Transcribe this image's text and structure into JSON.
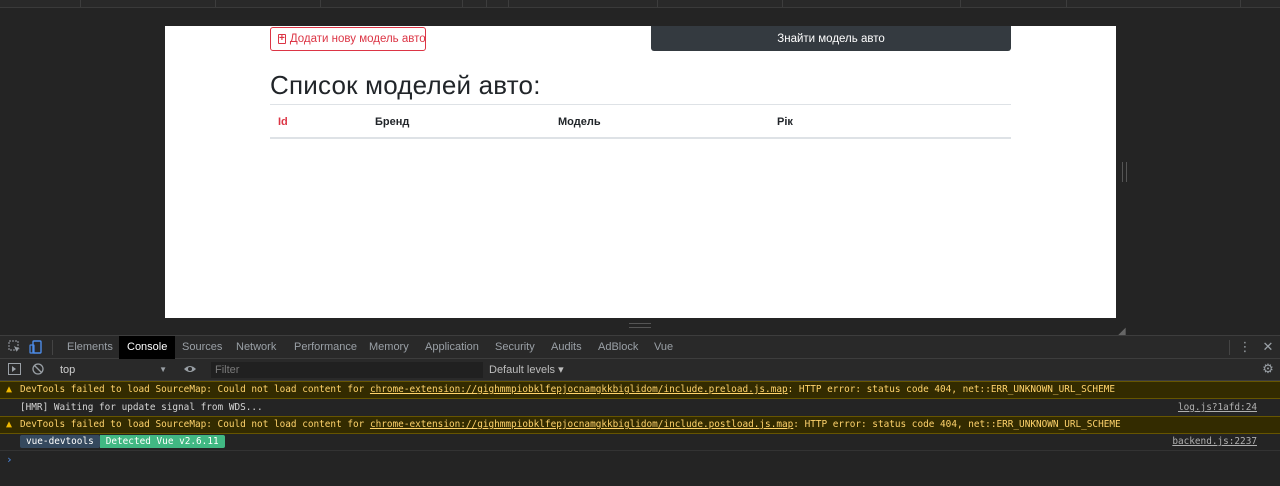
{
  "page": {
    "add_button_label": "Додати нову модель авто",
    "find_button_label": "Знайти модель авто",
    "title": "Список моделей авто:",
    "table": {
      "headers": [
        "Id",
        "Бренд",
        "Модель",
        "Рік"
      ],
      "sorted_header_color": "#dc3545"
    }
  },
  "devtools": {
    "tabs": [
      "Elements",
      "Console",
      "Sources",
      "Network",
      "Performance",
      "Memory",
      "Application",
      "Security",
      "Audits",
      "AdBlock",
      "Vue"
    ],
    "active_tab": "Console",
    "toolbar": {
      "context": "top",
      "filter_placeholder": "Filter",
      "levels": "Default levels ▾"
    },
    "messages": {
      "m1": {
        "prefix": "DevTools failed to load SourceMap: Could not load content for ",
        "link": "chrome-extension://gighmmpiobklfepjocnamgkkbiglidom/include.preload.js.map",
        "suffix": ": HTTP error: status code 404, net::ERR_UNKNOWN_URL_SCHEME"
      },
      "m2": {
        "text": "[HMR] Waiting for update signal from WDS...",
        "source": "log.js?1afd:24"
      },
      "m3": {
        "prefix": "DevTools failed to load SourceMap: Could not load content for ",
        "link": "chrome-extension://gighmmpiobklfepjocnamgkkbiglidom/include.postload.js.map",
        "suffix": ": HTTP error: status code 404, net::ERR_UNKNOWN_URL_SCHEME"
      },
      "m4": {
        "badge1": "vue-devtools",
        "badge2": "Detected Vue v2.6.11",
        "source": "backend.js:2237"
      }
    },
    "prompt": "›"
  },
  "icons": {
    "inspect": "inspect-element-icon",
    "device": "device-toggle-icon",
    "more": "more-vert-icon",
    "close": "close-icon",
    "sidebar": "console-sidebar-icon",
    "clear": "clear-console-icon",
    "eye": "live-expression-eye-icon",
    "settings": "gear-icon",
    "warning": "warning-icon"
  }
}
